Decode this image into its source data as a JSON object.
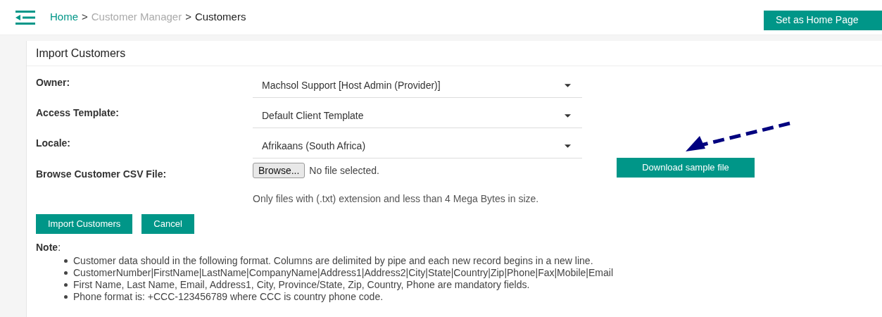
{
  "breadcrumb": {
    "separator": ">",
    "items": [
      {
        "label": "Home",
        "kind": "link"
      },
      {
        "label": "Customer Manager",
        "kind": "muted"
      },
      {
        "label": "Customers",
        "kind": "current"
      }
    ]
  },
  "home_button": "Set as Home Page",
  "panel": {
    "title": "Import Customers",
    "fields": [
      {
        "label": "Owner:",
        "value": "Machsol Support [Host Admin (Provider)]"
      },
      {
        "label": "Access Template:",
        "value": "Default Client Template"
      },
      {
        "label": "Locale:",
        "value": "Afrikaans (South Africa)"
      }
    ],
    "file": {
      "label": "Browse Customer CSV File:",
      "button": "Browse...",
      "status": "No file selected.",
      "hint": "Only files with (.txt) extension and less than 4 Mega Bytes in size."
    },
    "download_button": "Download sample file",
    "actions": [
      "Import Customers",
      "Cancel"
    ],
    "note": {
      "title": "**Note**:",
      "items": [
        "Customer data should in the following format. Columns are delimited by pipe and each new record begins in a new line.",
        "CustomerNumber|FirstName|LastName|CompanyName|Address1|Address2|City|State|Country|Zip|Phone|Fax|Mobile|Email",
        "First Name, Last Name, Email, Address1, City, Province/State, Zip, Country, Phone are mandatory fields.",
        "Phone format is: +CCC-123456789 where CCC is country phone code."
      ]
    }
  }
}
